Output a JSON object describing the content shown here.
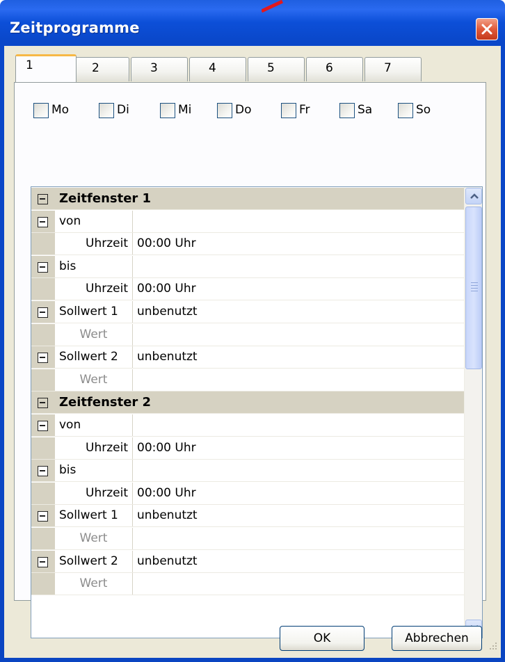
{
  "window": {
    "title": "Zeitprogramme"
  },
  "tabs": [
    "1",
    "2",
    "3",
    "4",
    "5",
    "6",
    "7"
  ],
  "days": [
    "Mo",
    "Di",
    "Mi",
    "Do",
    "Fr",
    "Sa",
    "So"
  ],
  "rows": [
    {
      "type": "section",
      "label": "Zeitfenster 1"
    },
    {
      "type": "node",
      "label": "von",
      "value": ""
    },
    {
      "type": "child",
      "label": "Uhrzeit",
      "value": "00:00 Uhr"
    },
    {
      "type": "node",
      "label": "bis",
      "value": ""
    },
    {
      "type": "child",
      "label": "Uhrzeit",
      "value": "00:00 Uhr"
    },
    {
      "type": "node",
      "label": "Sollwert 1",
      "value": "unbenutzt"
    },
    {
      "type": "child-grey",
      "label": "Wert",
      "value": ""
    },
    {
      "type": "node",
      "label": "Sollwert 2",
      "value": "unbenutzt"
    },
    {
      "type": "child-grey",
      "label": "Wert",
      "value": ""
    },
    {
      "type": "section",
      "label": "Zeitfenster 2"
    },
    {
      "type": "node",
      "label": "von",
      "value": ""
    },
    {
      "type": "child",
      "label": "Uhrzeit",
      "value": "00:00 Uhr"
    },
    {
      "type": "node",
      "label": "bis",
      "value": ""
    },
    {
      "type": "child",
      "label": "Uhrzeit",
      "value": "00:00 Uhr"
    },
    {
      "type": "node",
      "label": "Sollwert 1",
      "value": "unbenutzt"
    },
    {
      "type": "child-grey",
      "label": "Wert",
      "value": ""
    },
    {
      "type": "node",
      "label": "Sollwert 2",
      "value": "unbenutzt"
    },
    {
      "type": "child-grey",
      "label": "Wert",
      "value": ""
    }
  ],
  "buttons": {
    "ok": "OK",
    "cancel": "Abbrechen"
  },
  "colors": {
    "titlebar": "#0a47c9",
    "dialog": "#ece9d8",
    "section": "#d6d2c2",
    "close": "#e05a3a",
    "active_tab_accent": "#f7b845"
  }
}
